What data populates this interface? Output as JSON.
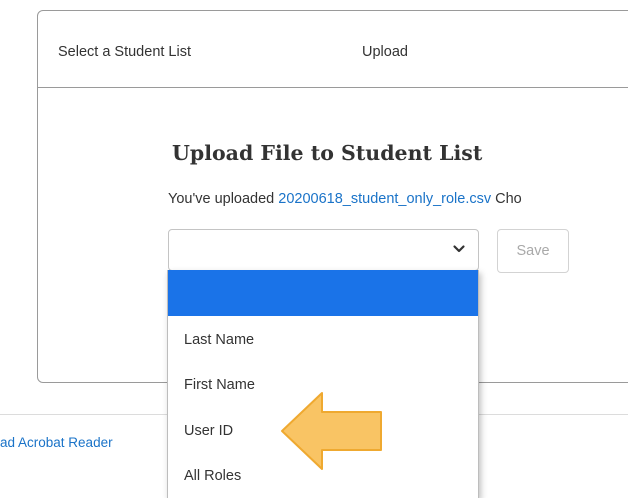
{
  "steps": {
    "step1_label": "Select a Student List",
    "step2_label": "Upload"
  },
  "main": {
    "title": "Upload File to Student List",
    "uploaded_prefix": "You've uploaded ",
    "file_name": "20200618_student_only_role.csv",
    "choose_fragment": " Cho"
  },
  "column_select": {
    "selected_value": "",
    "options": [
      "",
      "Last Name",
      "First Name",
      "User ID",
      "All Roles"
    ],
    "highlight_color": "#1a73e8"
  },
  "save_button": {
    "label": "Save"
  },
  "footer": {
    "link_text": "ad Acrobat Reader"
  },
  "annotation": {
    "arrow_color": "#f9c464",
    "arrow_stroke": "#efa930",
    "arrow_icon": "left-arrow-icon"
  }
}
